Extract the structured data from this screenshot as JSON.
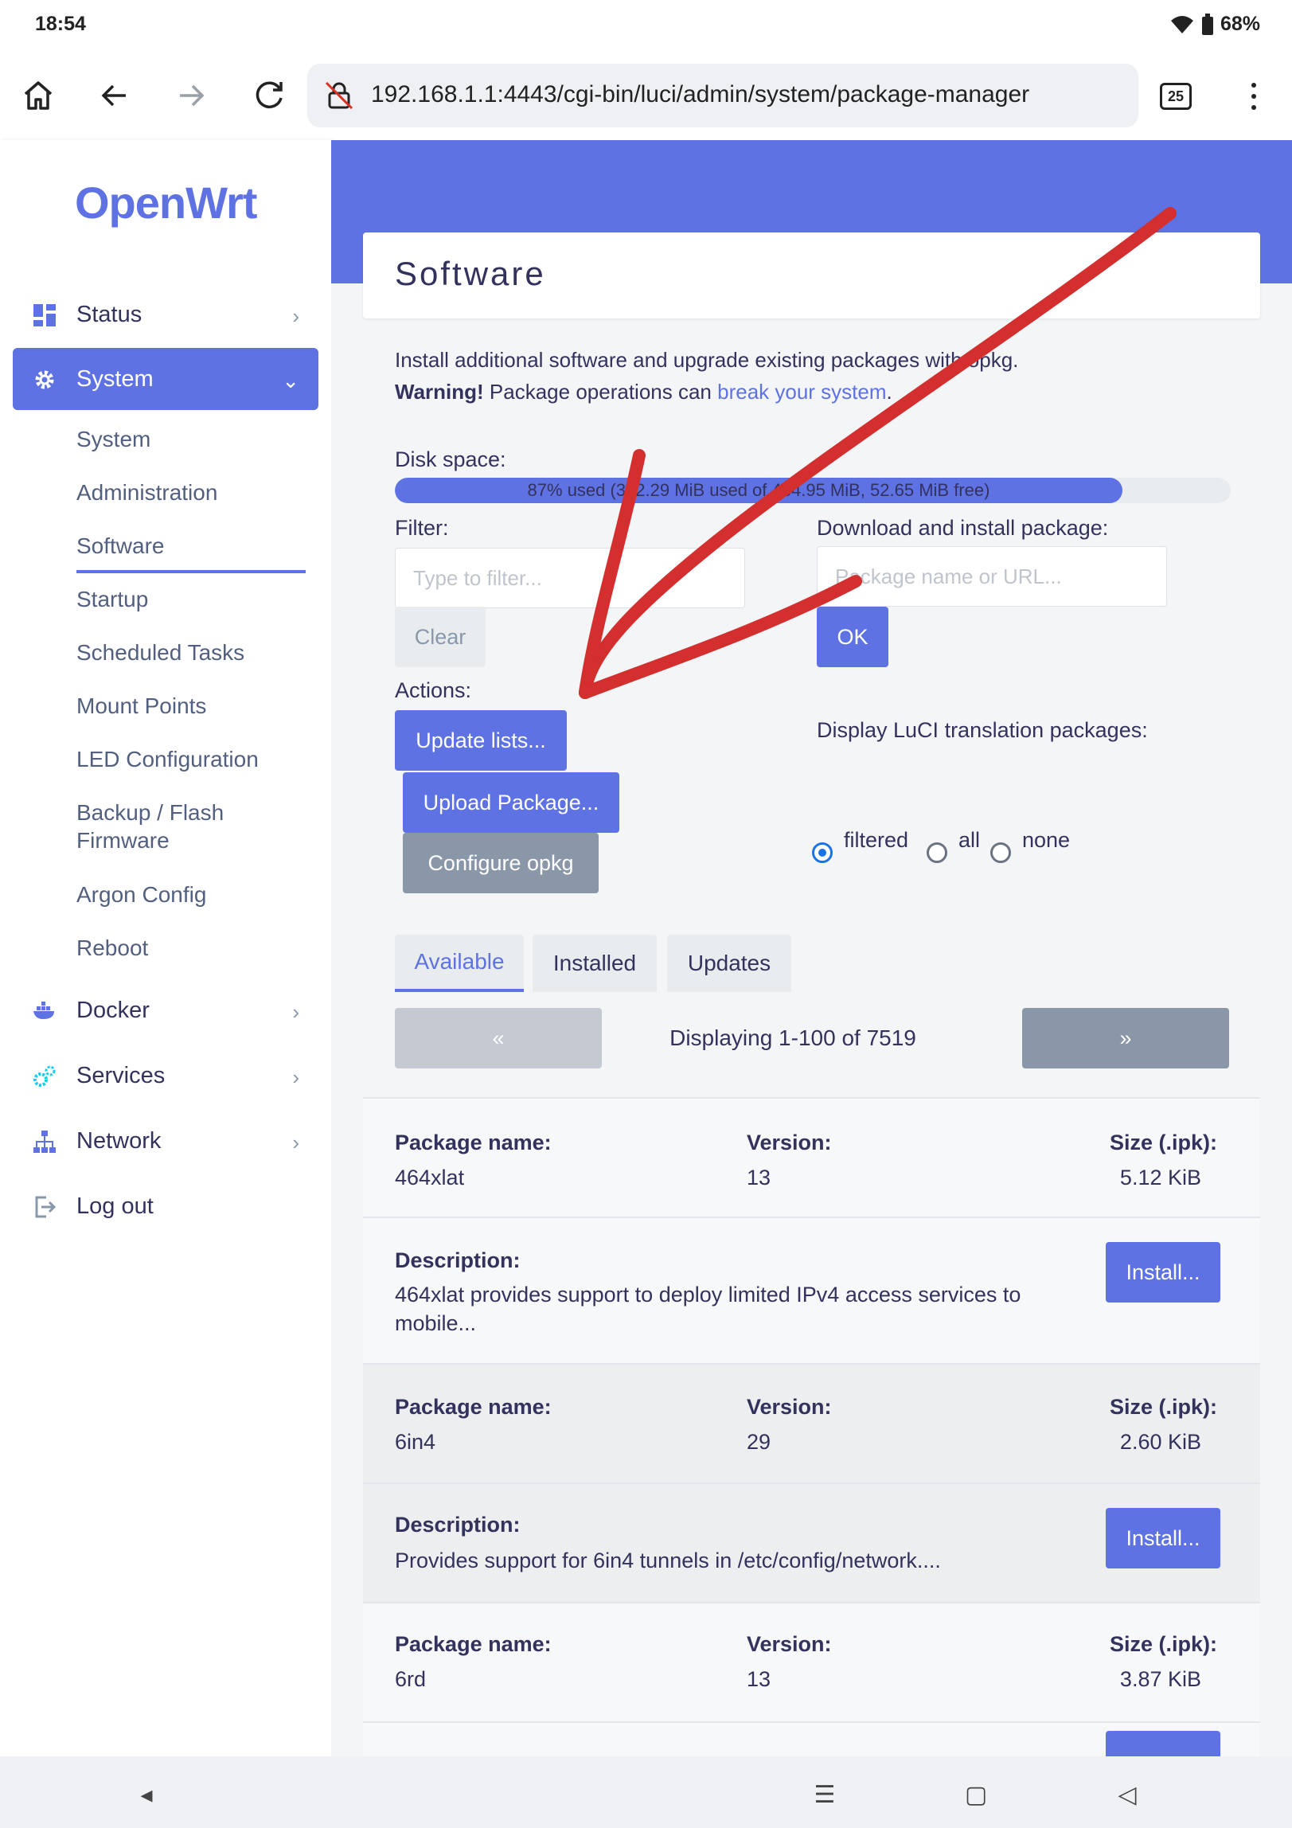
{
  "status_bar": {
    "time": "18:54",
    "battery": "68%"
  },
  "browser": {
    "url": "192.168.1.1:4443/cgi-bin/luci/admin/system/package-manager",
    "tab_count": "25"
  },
  "sidebar": {
    "logo": "OpenWrt",
    "items": [
      {
        "label": "Status",
        "icon": "dashboard-icon"
      },
      {
        "label": "System",
        "icon": "gear-icon"
      },
      {
        "label": "Docker",
        "icon": "docker-icon"
      },
      {
        "label": "Services",
        "icon": "services-icon"
      },
      {
        "label": "Network",
        "icon": "network-icon"
      },
      {
        "label": "Log out",
        "icon": "logout-icon"
      }
    ],
    "system_sub": [
      "System",
      "Administration",
      "Software",
      "Startup",
      "Scheduled Tasks",
      "Mount Points",
      "LED Configuration",
      "Backup / Flash",
      "Firmware",
      "Argon Config",
      "Reboot"
    ],
    "active_sub": "Software"
  },
  "page": {
    "title": "Software",
    "intro_line1": "Install additional software and upgrade existing packages with opkg.",
    "warning_bold": "Warning!",
    "warning_text": " Package operations can ",
    "warning_link": "break your system",
    "warning_end": ".",
    "disk_label": "Disk space:",
    "disk_text": "87% used (382.29 MiB used of 434.95 MiB, 52.65 MiB free)",
    "disk_used_fraction": 0.87,
    "filter_label": "Filter:",
    "filter_placeholder": "Type to filter...",
    "clear_button": "Clear",
    "download_label": "Download and install package:",
    "download_placeholder": "Package name or URL...",
    "ok_button": "OK",
    "actions_label": "Actions:",
    "update_button": "Update lists...",
    "upload_button": "Upload Package...",
    "configure_button": "Configure opkg",
    "translation_label": "Display LuCI translation packages:",
    "translation_options": [
      "filtered",
      "all",
      "none"
    ],
    "translation_selected": "filtered",
    "tabs": [
      "Available",
      "Installed",
      "Updates"
    ],
    "active_tab": "Available",
    "pager_prev": "«",
    "pager_next": "»",
    "pager_text": "Displaying 1-100 of 7519"
  },
  "table": {
    "name_label": "Package name:",
    "version_label": "Version:",
    "size_label": "Size (.ipk):",
    "desc_label": "Description:",
    "install_button": "Install...",
    "packages": [
      {
        "name": "464xlat",
        "version": "13",
        "size": "5.12 KiB",
        "description": "464xlat provides support to deploy limited IPv4 access services to mobile..."
      },
      {
        "name": "6in4",
        "version": "29",
        "size": "2.60 KiB",
        "description": "Provides support for 6in4 tunnels in /etc/config/network...."
      },
      {
        "name": "6rd",
        "version": "13",
        "size": "3.87 KiB"
      }
    ]
  },
  "colors": {
    "accent": "#5e72e4",
    "annotation": "#d32f2f"
  }
}
